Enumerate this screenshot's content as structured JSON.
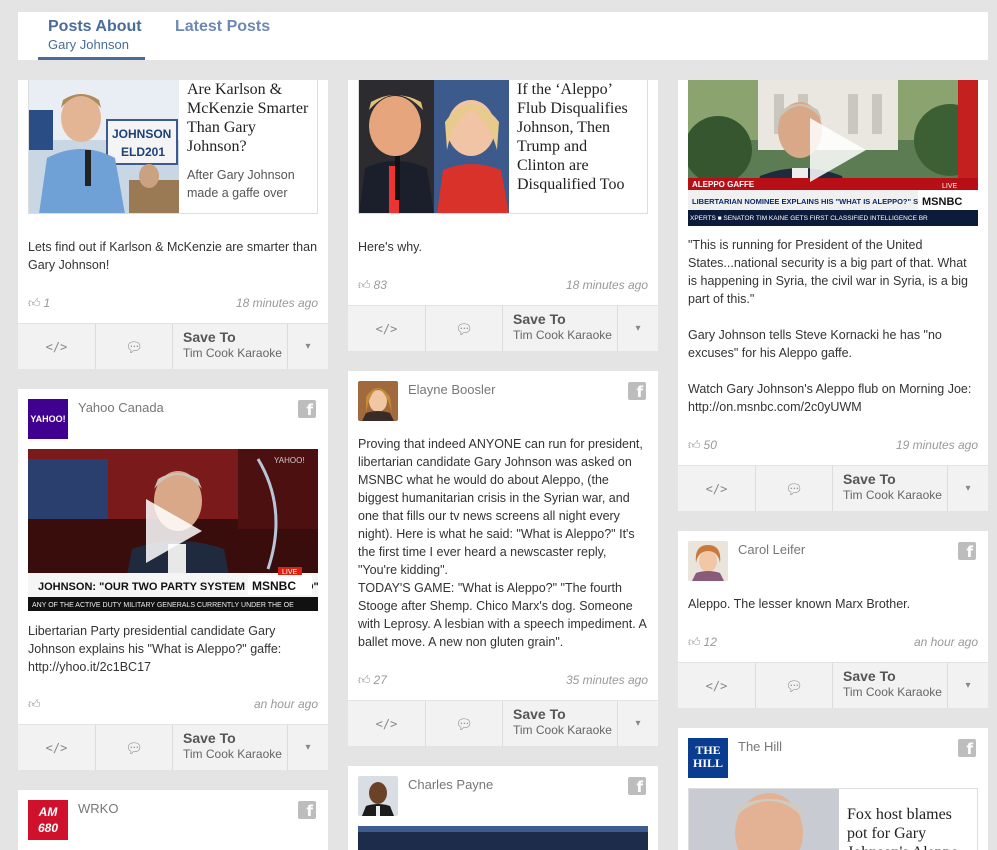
{
  "tabs": {
    "posts_about_title": "Posts About",
    "posts_about_sub": "Gary Johnson",
    "latest_title": "Latest Posts"
  },
  "actions": {
    "embed_icon": "</>",
    "comment_icon": "speech-bubble-icon",
    "save_label": "Save To",
    "save_target": "Tim Cook Karaoke",
    "dropdown_icon": "▾"
  },
  "cards": {
    "karlson": {
      "link_title": "Are Karlson & McKenzie Smarter Than Gary Johnson?",
      "link_desc": "After Gary Johnson made a gaffe over",
      "text": "Lets find out if Karlson & McKenzie are smarter than Gary Johnson!",
      "likes": "1",
      "time": "18 minutes ago"
    },
    "aleppo_flub": {
      "link_title": "If the ‘Aleppo’ Flub Disqualifies Johnson, Then Trump and Clinton are Disqualified Too",
      "text": "Here's why.",
      "likes": "83",
      "time": "18 minutes ago"
    },
    "msnbc": {
      "video_chyron": "LIBERTARIAN NOMINEE EXPLAINS HIS \"WHAT IS ALEPPO?\" STUMBLE",
      "video_tag": "ALEPPO GAFFE",
      "video_ticker": "XPERTS  ■  SENATOR TIM KAINE GETS FIRST CLASSIFIED INTELLIGENCE BR",
      "video_logo": "MSNBC",
      "video_live": "LIVE",
      "text_1": "\"This is running for President of the United States...national security is a big part of that. What is happening in Syria, the civil war in Syria, is a big part of this.\"",
      "text_2": "Gary Johnson tells Steve Kornacki he has \"no excuses\" for his Aleppo gaffe.",
      "text_3": "Watch Gary Johnson's Aleppo flub on Morning Joe: http://on.msnbc.com/2c0yUWM",
      "likes": "50",
      "time": "19 minutes ago"
    },
    "yahoo": {
      "source": "Yahoo Canada",
      "logo_text": "YAHOO!",
      "video_chyron": "JOHNSON: \"OUR TWO PARTY SYSTEM HAS FAILED\"",
      "video_ticker": "ANY OF THE ACTIVE DUTY MILITARY GENERALS CURRENTLY UNDER THE OE",
      "video_logo": "MSNBC",
      "video_live": "LIVE",
      "video_corner": "YAHOO!",
      "text": "Libertarian Party presidential candidate Gary Johnson explains his \"What is Aleppo?\" gaffe: http://yhoo.it/2c1BC17",
      "likes": "",
      "time": "an hour ago"
    },
    "boosler": {
      "source": "Elayne Boosler",
      "text_1": "Proving that indeed ANYONE can run for president, libertarian candidate Gary Johnson was asked on MSNBC what he would do about Aleppo, (the biggest humanitarian crisis in the Syrian war, and one that fills our tv news screens all night every night). Here is what he said: \"What is Aleppo?\" It's the first time I ever heard a newscaster reply, \"You're kidding\".",
      "text_2": "TODAY'S GAME: \"What is Aleppo?\" \"The fourth Stooge after Shemp. Chico Marx's dog. Someone with Leprosy. A lesbian with a speech impediment. A ballet move. A new non gluten grain\".",
      "likes": "27",
      "time": "35 minutes ago"
    },
    "leifer": {
      "source": "Carol Leifer",
      "text": "Aleppo. The lesser known Marx Brother.",
      "likes": "12",
      "time": "an hour ago"
    },
    "wrko": {
      "source": "WRKO",
      "logo_line1": "AM",
      "logo_line2": "680"
    },
    "payne": {
      "source": "Charles Payne"
    },
    "thehill": {
      "source": "The Hill",
      "logo_line1": "THE",
      "logo_line2": "HILL",
      "link_title": "Fox host blames pot for Gary Johnson's Aleppo"
    }
  },
  "colors": {
    "accent": "#4a6c9b",
    "background": "#e4e4e4",
    "yahoo_purple": "#400090",
    "wrko_red": "#d0112b",
    "hill_blue": "#0a3d8f"
  }
}
